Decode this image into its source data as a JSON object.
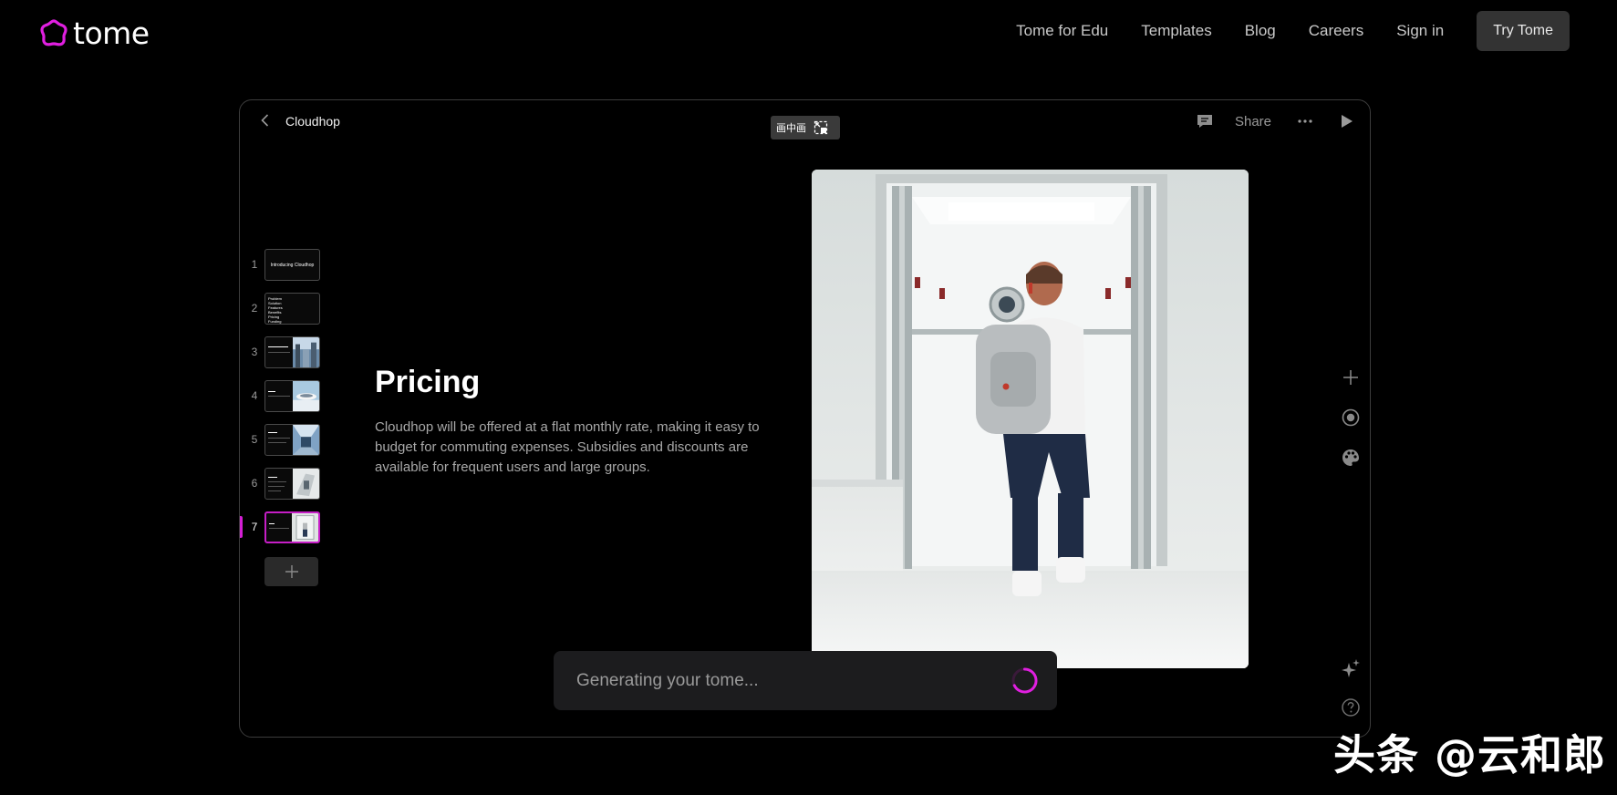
{
  "brand": {
    "name": "tome",
    "accent": "#e01fe0"
  },
  "nav": {
    "links": [
      "Tome for Edu",
      "Templates",
      "Blog",
      "Careers",
      "Sign in"
    ],
    "cta": "Try Tome"
  },
  "editor": {
    "doc_title": "Cloudhop",
    "pip_label": "画中画",
    "share_label": "Share",
    "icons": [
      "back-chevron-icon",
      "pip-icon",
      "comment-icon",
      "more-icon",
      "play-icon"
    ]
  },
  "thumbnails": {
    "numbers": [
      "1",
      "2",
      "3",
      "4",
      "5",
      "6",
      "7"
    ],
    "active_index": 7,
    "slide1_title": "Introducing Cloudhop",
    "slide2_lines": "Problem\nSolution\nFeatures\nBenefits\nPricing\nFunding"
  },
  "slide": {
    "heading": "Pricing",
    "body": "Cloudhop will be offered at a flat monthly rate, making it easy to budget for commuting expenses. Subsidies and discounts are available for frequent users and large groups."
  },
  "tools": [
    "add-icon",
    "record-icon",
    "palette-icon",
    "sparkle-icon",
    "help-icon"
  ],
  "prompt": {
    "status": "Generating your tome..."
  },
  "watermark": "头条 @云和郎"
}
